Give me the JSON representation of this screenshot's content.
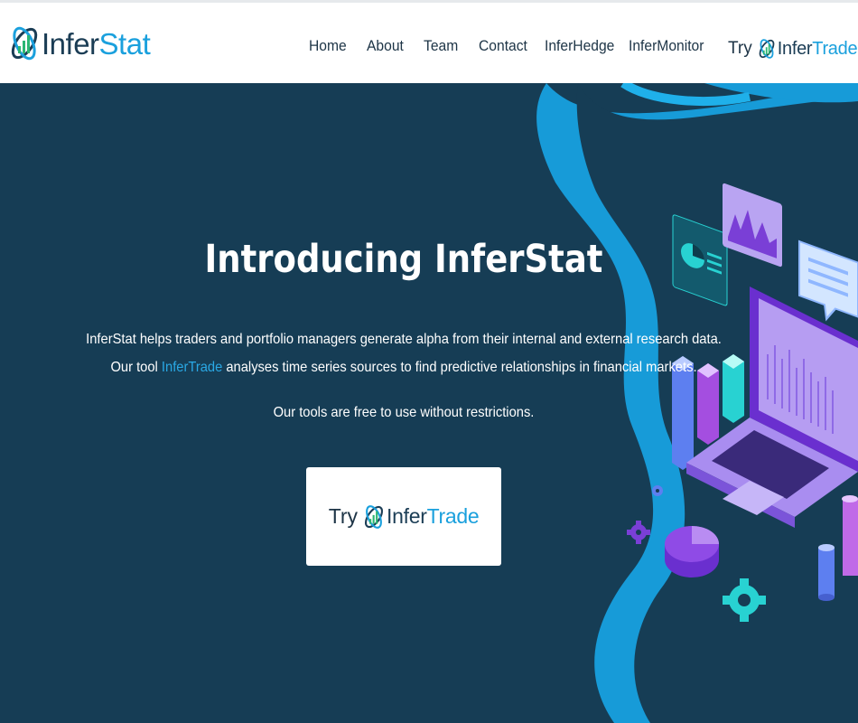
{
  "brand": {
    "name_part1": "Infer",
    "name_part2": "Stat",
    "colors": {
      "dark": "#1b3d55",
      "accent": "#1aa0dd",
      "hero_bg": "#163d55",
      "link": "#2aa9e6"
    }
  },
  "nav": {
    "items": [
      {
        "label": "Home"
      },
      {
        "label": "About"
      },
      {
        "label": "Team"
      },
      {
        "label": "Contact"
      },
      {
        "label": "InferHedge"
      },
      {
        "label": "InferMonitor"
      }
    ],
    "cta": {
      "try": "Try",
      "brand_part1": "Infer",
      "brand_part2": "Trade"
    }
  },
  "hero": {
    "title": "Introducing InferStat",
    "line1": "InferStat helps traders and portfolio managers generate alpha from their internal and external research data.",
    "line2_before": "Our tool ",
    "line2_link": "InferTrade",
    "line2_after": " analyses time series sources to find predictive relationships in financial markets.",
    "line3": "Our tools are free to use without restrictions.",
    "cta": {
      "try": "Try",
      "brand_part1": "Infer",
      "brand_part2": "Trade"
    }
  },
  "icons": {
    "logo": "infer-logo-icon",
    "illustration": "analytics-laptop-illustration"
  }
}
